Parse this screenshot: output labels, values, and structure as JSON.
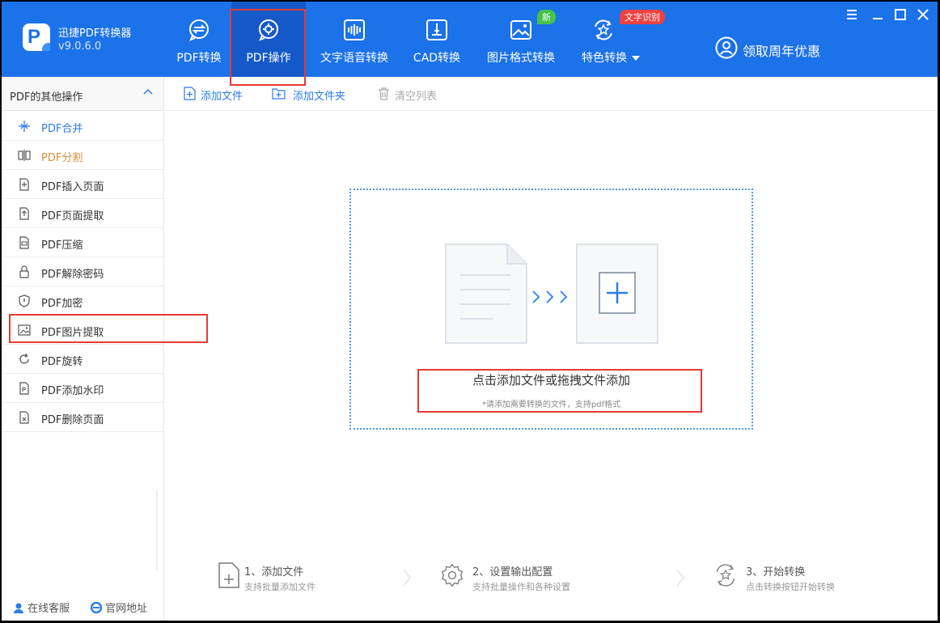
{
  "app": {
    "name": "迅捷PDF转换器",
    "version": "v9.0.6.0"
  },
  "nav": [
    {
      "label": "PDF转换",
      "icon": "convert-icon"
    },
    {
      "label": "PDF操作",
      "icon": "pdf-operation-icon",
      "active": true
    },
    {
      "label": "文字语音转换",
      "icon": "audio-wave-icon"
    },
    {
      "label": "CAD转换",
      "icon": "cad-icon"
    },
    {
      "label": "图片格式转换",
      "icon": "image-icon",
      "badge": "新"
    },
    {
      "label": "特色转换",
      "icon": "special-icon",
      "badge": "文字识别"
    }
  ],
  "promo": {
    "label": "领取周年优惠",
    "icon": "user-icon"
  },
  "window_controls": [
    "menu-icon",
    "minimize-icon",
    "maximize-icon",
    "close-icon"
  ],
  "sidebar": {
    "title": "PDF的其他操作",
    "items": [
      {
        "label": "PDF合并",
        "icon": "merge-icon",
        "state": "blue"
      },
      {
        "label": "PDF分割",
        "icon": "split-icon",
        "state": "orange"
      },
      {
        "label": "PDF插入页面",
        "icon": "insert-page-icon"
      },
      {
        "label": "PDF页面提取",
        "icon": "page-extract-icon"
      },
      {
        "label": "PDF压缩",
        "icon": "compress-icon"
      },
      {
        "label": "PDF解除密码",
        "icon": "unlock-icon"
      },
      {
        "label": "PDF加密",
        "icon": "shield-icon"
      },
      {
        "label": "PDF图片提取",
        "icon": "image-extract-icon"
      },
      {
        "label": "PDF旋转",
        "icon": "rotate-icon"
      },
      {
        "label": "PDF添加水印",
        "icon": "watermark-icon"
      },
      {
        "label": "PDF删除页面",
        "icon": "delete-page-icon"
      }
    ],
    "footer": {
      "service": "在线客服",
      "website": "官网地址"
    }
  },
  "toolbar": {
    "add_file": "添加文件",
    "add_folder": "添加文件夹",
    "clear_list": "清空列表"
  },
  "dropzone": {
    "title": "点击添加文件或拖拽文件添加",
    "subtitle": "*请添加需要转换的文件，支持pdf格式"
  },
  "steps": [
    {
      "title": "1、添加文件",
      "desc": "支持批量添加文件",
      "icon": "add-file-icon"
    },
    {
      "title": "2、设置输出配置",
      "desc": "支持批量操作和各种设置",
      "icon": "settings-gear-icon"
    },
    {
      "title": "3、开始转换",
      "desc": "点击转换按钮开始转换",
      "icon": "start-convert-icon"
    }
  ],
  "colors": {
    "brand": "#1C72E8",
    "active_tab": "#1559C9",
    "link": "#2C7CE6",
    "highlight": "#E53935"
  }
}
